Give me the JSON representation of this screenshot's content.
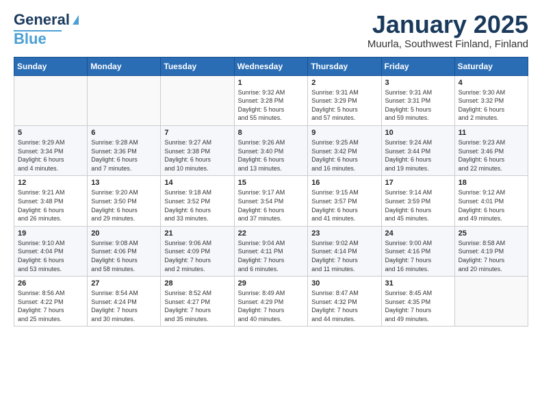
{
  "header": {
    "logo_general": "General",
    "logo_blue": "Blue",
    "title": "January 2025",
    "subtitle": "Muurla, Southwest Finland, Finland"
  },
  "weekdays": [
    "Sunday",
    "Monday",
    "Tuesday",
    "Wednesday",
    "Thursday",
    "Friday",
    "Saturday"
  ],
  "weeks": [
    {
      "days": [
        {
          "num": "",
          "info": ""
        },
        {
          "num": "",
          "info": ""
        },
        {
          "num": "",
          "info": ""
        },
        {
          "num": "1",
          "info": "Sunrise: 9:32 AM\nSunset: 3:28 PM\nDaylight: 5 hours\nand 55 minutes."
        },
        {
          "num": "2",
          "info": "Sunrise: 9:31 AM\nSunset: 3:29 PM\nDaylight: 5 hours\nand 57 minutes."
        },
        {
          "num": "3",
          "info": "Sunrise: 9:31 AM\nSunset: 3:31 PM\nDaylight: 5 hours\nand 59 minutes."
        },
        {
          "num": "4",
          "info": "Sunrise: 9:30 AM\nSunset: 3:32 PM\nDaylight: 6 hours\nand 2 minutes."
        }
      ]
    },
    {
      "days": [
        {
          "num": "5",
          "info": "Sunrise: 9:29 AM\nSunset: 3:34 PM\nDaylight: 6 hours\nand 4 minutes."
        },
        {
          "num": "6",
          "info": "Sunrise: 9:28 AM\nSunset: 3:36 PM\nDaylight: 6 hours\nand 7 minutes."
        },
        {
          "num": "7",
          "info": "Sunrise: 9:27 AM\nSunset: 3:38 PM\nDaylight: 6 hours\nand 10 minutes."
        },
        {
          "num": "8",
          "info": "Sunrise: 9:26 AM\nSunset: 3:40 PM\nDaylight: 6 hours\nand 13 minutes."
        },
        {
          "num": "9",
          "info": "Sunrise: 9:25 AM\nSunset: 3:42 PM\nDaylight: 6 hours\nand 16 minutes."
        },
        {
          "num": "10",
          "info": "Sunrise: 9:24 AM\nSunset: 3:44 PM\nDaylight: 6 hours\nand 19 minutes."
        },
        {
          "num": "11",
          "info": "Sunrise: 9:23 AM\nSunset: 3:46 PM\nDaylight: 6 hours\nand 22 minutes."
        }
      ]
    },
    {
      "days": [
        {
          "num": "12",
          "info": "Sunrise: 9:21 AM\nSunset: 3:48 PM\nDaylight: 6 hours\nand 26 minutes."
        },
        {
          "num": "13",
          "info": "Sunrise: 9:20 AM\nSunset: 3:50 PM\nDaylight: 6 hours\nand 29 minutes."
        },
        {
          "num": "14",
          "info": "Sunrise: 9:18 AM\nSunset: 3:52 PM\nDaylight: 6 hours\nand 33 minutes."
        },
        {
          "num": "15",
          "info": "Sunrise: 9:17 AM\nSunset: 3:54 PM\nDaylight: 6 hours\nand 37 minutes."
        },
        {
          "num": "16",
          "info": "Sunrise: 9:15 AM\nSunset: 3:57 PM\nDaylight: 6 hours\nand 41 minutes."
        },
        {
          "num": "17",
          "info": "Sunrise: 9:14 AM\nSunset: 3:59 PM\nDaylight: 6 hours\nand 45 minutes."
        },
        {
          "num": "18",
          "info": "Sunrise: 9:12 AM\nSunset: 4:01 PM\nDaylight: 6 hours\nand 49 minutes."
        }
      ]
    },
    {
      "days": [
        {
          "num": "19",
          "info": "Sunrise: 9:10 AM\nSunset: 4:04 PM\nDaylight: 6 hours\nand 53 minutes."
        },
        {
          "num": "20",
          "info": "Sunrise: 9:08 AM\nSunset: 4:06 PM\nDaylight: 6 hours\nand 58 minutes."
        },
        {
          "num": "21",
          "info": "Sunrise: 9:06 AM\nSunset: 4:09 PM\nDaylight: 7 hours\nand 2 minutes."
        },
        {
          "num": "22",
          "info": "Sunrise: 9:04 AM\nSunset: 4:11 PM\nDaylight: 7 hours\nand 6 minutes."
        },
        {
          "num": "23",
          "info": "Sunrise: 9:02 AM\nSunset: 4:14 PM\nDaylight: 7 hours\nand 11 minutes."
        },
        {
          "num": "24",
          "info": "Sunrise: 9:00 AM\nSunset: 4:16 PM\nDaylight: 7 hours\nand 16 minutes."
        },
        {
          "num": "25",
          "info": "Sunrise: 8:58 AM\nSunset: 4:19 PM\nDaylight: 7 hours\nand 20 minutes."
        }
      ]
    },
    {
      "days": [
        {
          "num": "26",
          "info": "Sunrise: 8:56 AM\nSunset: 4:22 PM\nDaylight: 7 hours\nand 25 minutes."
        },
        {
          "num": "27",
          "info": "Sunrise: 8:54 AM\nSunset: 4:24 PM\nDaylight: 7 hours\nand 30 minutes."
        },
        {
          "num": "28",
          "info": "Sunrise: 8:52 AM\nSunset: 4:27 PM\nDaylight: 7 hours\nand 35 minutes."
        },
        {
          "num": "29",
          "info": "Sunrise: 8:49 AM\nSunset: 4:29 PM\nDaylight: 7 hours\nand 40 minutes."
        },
        {
          "num": "30",
          "info": "Sunrise: 8:47 AM\nSunset: 4:32 PM\nDaylight: 7 hours\nand 44 minutes."
        },
        {
          "num": "31",
          "info": "Sunrise: 8:45 AM\nSunset: 4:35 PM\nDaylight: 7 hours\nand 49 minutes."
        },
        {
          "num": "",
          "info": ""
        }
      ]
    }
  ]
}
